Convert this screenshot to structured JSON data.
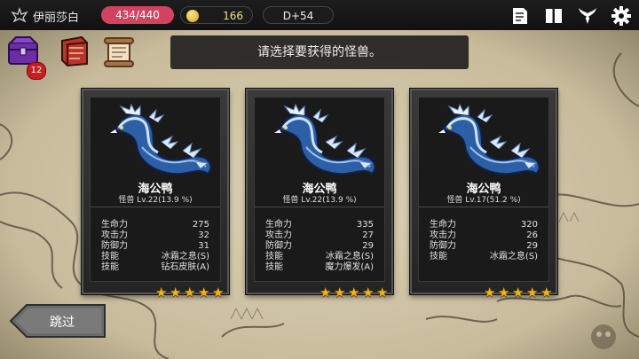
{
  "topbar": {
    "player_name": "伊丽莎白",
    "hp": "434/440",
    "gold": "166",
    "day": "D+54"
  },
  "icons": {
    "crest": "crest-icon",
    "journal": "journal-icon",
    "map": "map-book-icon",
    "monster": "monster-horns-icon",
    "settings": "gear-icon",
    "chest": "treasure-chest-icon",
    "spellbook": "red-book-icon",
    "scroll": "scroll-icon"
  },
  "chest_badge": "12",
  "prompt": "请选择要获得的怪兽。",
  "cards": [
    {
      "name": "海公鸭",
      "level": "怪兽 Lv.22(13.9 %)",
      "stats": [
        {
          "label": "生命力",
          "value": "275"
        },
        {
          "label": "攻击力",
          "value": "32"
        },
        {
          "label": "防御力",
          "value": "31"
        },
        {
          "label": "技能",
          "value": "冰霜之息(S)"
        },
        {
          "label": "技能",
          "value": "钻石皮肤(A)"
        }
      ],
      "stars": 5
    },
    {
      "name": "海公鸭",
      "level": "怪兽 Lv.22(13.9 %)",
      "stats": [
        {
          "label": "生命力",
          "value": "335"
        },
        {
          "label": "攻击力",
          "value": "27"
        },
        {
          "label": "防御力",
          "value": "29"
        },
        {
          "label": "技能",
          "value": "冰霜之息(S)"
        },
        {
          "label": "技能",
          "value": "魔力爆发(A)"
        }
      ],
      "stars": 5
    },
    {
      "name": "海公鸭",
      "level": "怪兽 Lv.17(51.2 %)",
      "stats": [
        {
          "label": "生命力",
          "value": "320"
        },
        {
          "label": "攻击力",
          "value": "26"
        },
        {
          "label": "防御力",
          "value": "29"
        },
        {
          "label": "技能",
          "value": "冰霜之息(S)"
        }
      ],
      "stars": 5
    }
  ],
  "skip_label": "跳过",
  "colors": {
    "hp_pill": "#d2435f",
    "star": "#f0b21a",
    "badge": "#c81e22"
  }
}
